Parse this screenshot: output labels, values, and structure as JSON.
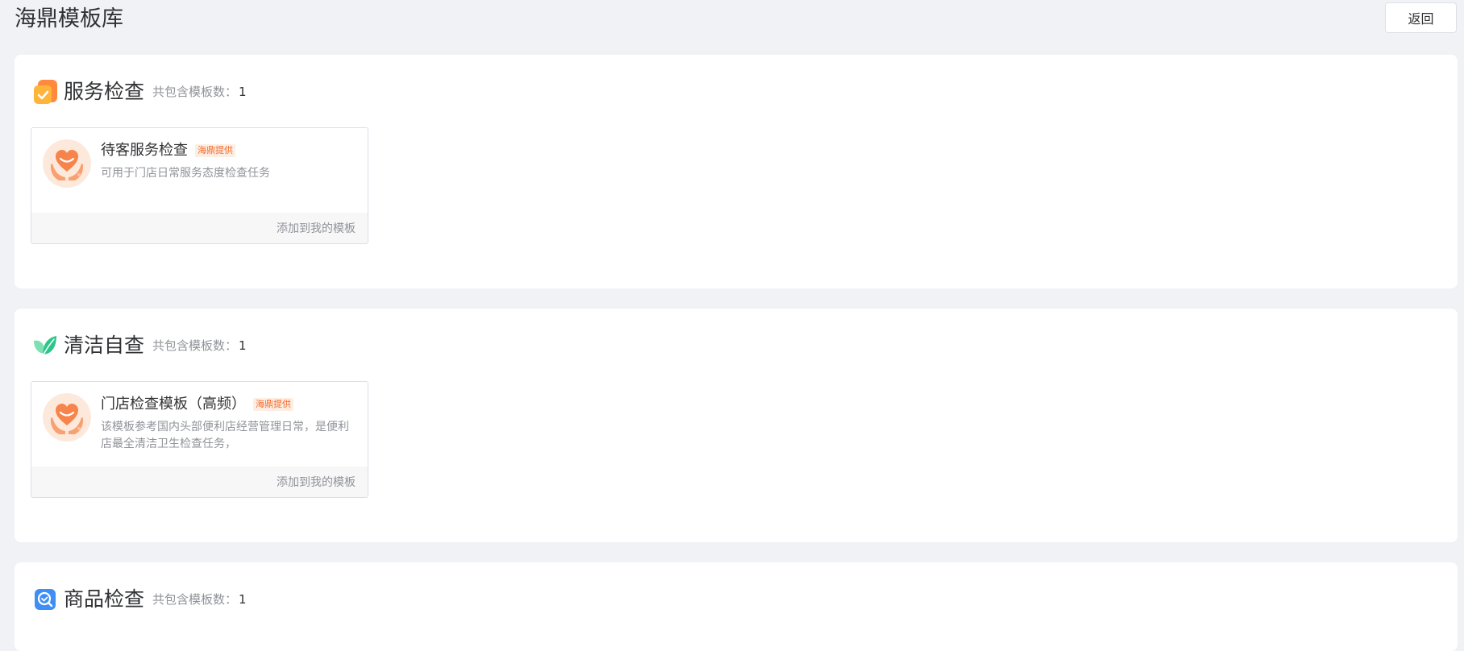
{
  "page": {
    "title": "海鼎模板库",
    "back_label": "返回"
  },
  "colors": {
    "tag_text": "#f5692a",
    "tag_bg": "#fdeee4",
    "page_bg": "#f0f2f5"
  },
  "sections": [
    {
      "title": "服务检查",
      "count_label": "共包含模板数：",
      "count": "1",
      "icon": "service-check-icon",
      "templates": [
        {
          "name": "待客服务检查",
          "tag": "海鼎提供",
          "desc": "可用于门店日常服务态度检查任务",
          "action": "添加到我的模板",
          "icon": "heart-hands-icon"
        }
      ]
    },
    {
      "title": "清洁自查",
      "count_label": "共包含模板数：",
      "count": "1",
      "icon": "leaf-icon",
      "templates": [
        {
          "name": "门店检查模板（高频）",
          "tag": "海鼎提供",
          "desc": "该模板参考国内头部便利店经营管理日常，是便利店最全清洁卫生检查任务，",
          "action": "添加到我的模板",
          "icon": "heart-hands-icon"
        }
      ]
    },
    {
      "title": "商品检查",
      "count_label": "共包含模板数：",
      "count": "1",
      "icon": "product-check-icon",
      "templates": []
    }
  ]
}
